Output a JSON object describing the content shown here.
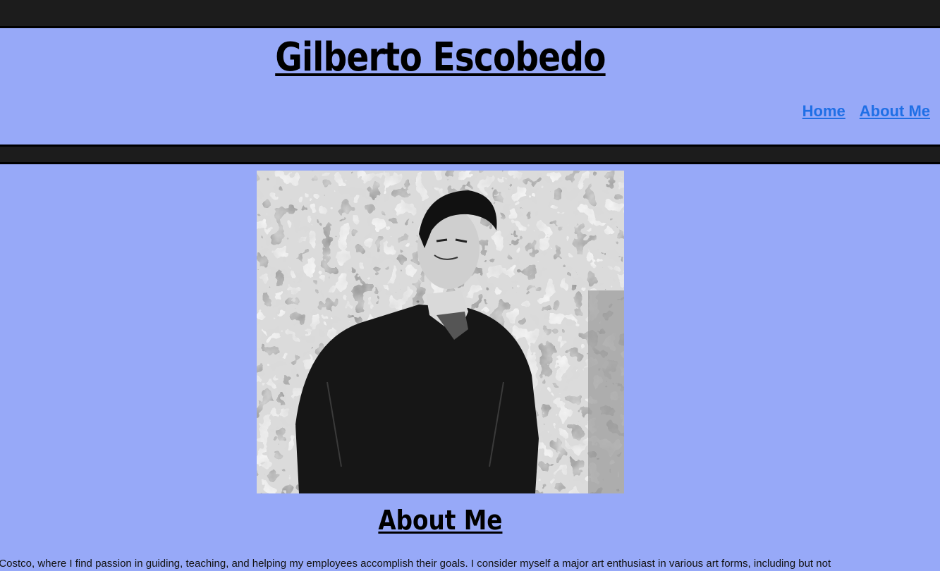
{
  "header": {
    "site_title": "Gilberto Escobedo",
    "nav": [
      {
        "label": "Home"
      },
      {
        "label": "About Me"
      }
    ]
  },
  "main": {
    "portrait_alt": "portrait",
    "about_heading": "About Me",
    "bio_visible_text": "t Costco, where I find passion in guiding, teaching, and helping my employees accomplish their goals. I consider myself a major art enthusiast in various art forms, including but not"
  },
  "colors": {
    "page_background": "#97a9f8",
    "bar": "#1c1c1c",
    "nav_link": "#1f6fe6"
  }
}
